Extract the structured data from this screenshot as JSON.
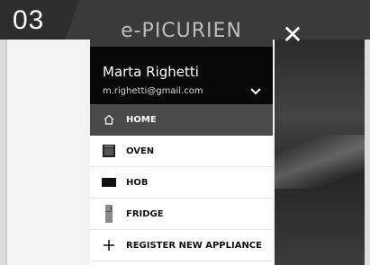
{
  "step": {
    "number": "03"
  },
  "brand": {
    "logo_text": "e-PICURIEN"
  },
  "user": {
    "name": "Marta Righetti",
    "email": "m.righetti@gmail.com"
  },
  "menu": {
    "items": [
      {
        "label": "HOME",
        "icon": "home-icon",
        "active": true
      },
      {
        "label": "OVEN",
        "icon": "oven-icon",
        "active": false
      },
      {
        "label": "HOB",
        "icon": "hob-icon",
        "active": false
      },
      {
        "label": "FRIDGE",
        "icon": "fridge-icon",
        "active": false
      },
      {
        "label": "REGISTER NEW APPLIANCE",
        "icon": "plus-icon",
        "active": false
      }
    ]
  },
  "close": {
    "icon": "close-icon",
    "glyph": "✕"
  },
  "colors": {
    "header_bg": "#080808",
    "active_item_bg": "#4a4a4a",
    "logo_bar_bg": "#3a3a3a"
  }
}
